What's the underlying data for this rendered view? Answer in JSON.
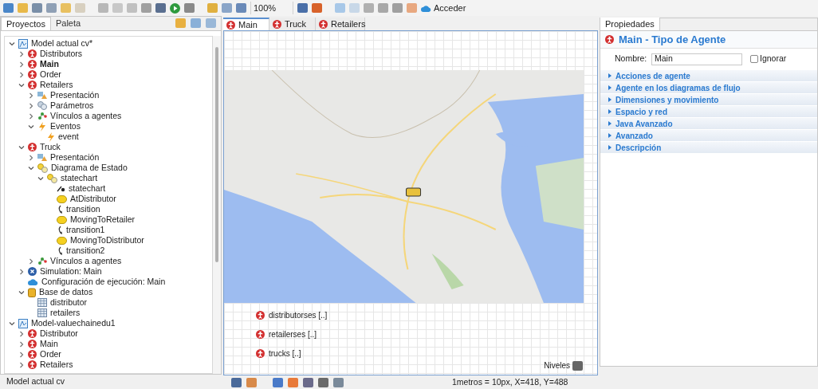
{
  "toolbar": {
    "zoom": "100%",
    "login": "Acceder"
  },
  "left_panel": {
    "tabs": [
      {
        "label": "Proyectos",
        "selected": true
      },
      {
        "label": "Paleta",
        "selected": false
      }
    ],
    "tree": [
      {
        "label": "Model actual cv*",
        "kind": "model",
        "expanded": true,
        "children": [
          {
            "label": "Distributors",
            "kind": "agent",
            "expanded": false
          },
          {
            "label": "Main",
            "kind": "agent",
            "expanded": false,
            "bold": true
          },
          {
            "label": "Order",
            "kind": "agent",
            "expanded": false
          },
          {
            "label": "Retailers",
            "kind": "agent",
            "expanded": true,
            "children": [
              {
                "label": "Presentación",
                "kind": "presentation",
                "expanded": false
              },
              {
                "label": "Parámetros",
                "kind": "parameters",
                "expanded": false
              },
              {
                "label": "Vínculos a agentes",
                "kind": "links",
                "expanded": false
              },
              {
                "label": "Eventos",
                "kind": "events",
                "expanded": true,
                "children": [
                  {
                    "label": "event",
                    "kind": "event"
                  }
                ]
              }
            ]
          },
          {
            "label": "Truck",
            "kind": "agent",
            "expanded": true,
            "children": [
              {
                "label": "Presentación",
                "kind": "presentation",
                "expanded": false
              },
              {
                "label": "Diagrama de Estado",
                "kind": "states",
                "expanded": true,
                "children": [
                  {
                    "label": "statechart",
                    "kind": "states",
                    "expanded": true,
                    "children": [
                      {
                        "label": "statechart",
                        "kind": "entry"
                      },
                      {
                        "label": "AtDistributor",
                        "kind": "state"
                      },
                      {
                        "label": "transition",
                        "kind": "transition"
                      },
                      {
                        "label": "MovingToRetailer",
                        "kind": "state"
                      },
                      {
                        "label": "transition1",
                        "kind": "transition"
                      },
                      {
                        "label": "MovingToDistributor",
                        "kind": "state"
                      },
                      {
                        "label": "transition2",
                        "kind": "transition"
                      }
                    ]
                  }
                ]
              },
              {
                "label": "Vínculos a agentes",
                "kind": "links",
                "expanded": false
              }
            ]
          },
          {
            "label": "Simulation: Main",
            "kind": "simulation",
            "expanded": false
          },
          {
            "label": "Configuración de ejecución: Main",
            "kind": "cloud"
          },
          {
            "label": "Base de datos",
            "kind": "database",
            "expanded": true,
            "children": [
              {
                "label": "distributor",
                "kind": "table"
              },
              {
                "label": "retailers",
                "kind": "table"
              }
            ]
          }
        ]
      },
      {
        "label": "Model-valuechainedu1",
        "kind": "model",
        "expanded": true,
        "children": [
          {
            "label": "Distributor",
            "kind": "agent",
            "expanded": false
          },
          {
            "label": "Main",
            "kind": "agent",
            "expanded": false
          },
          {
            "label": "Order",
            "kind": "agent",
            "expanded": false
          },
          {
            "label": "Retailers",
            "kind": "agent",
            "expanded": false
          }
        ]
      }
    ],
    "status": "Model actual cv"
  },
  "editor": {
    "tabs": [
      {
        "label": "Main",
        "selected": true
      },
      {
        "label": "Truck",
        "selected": false
      },
      {
        "label": "Retailers",
        "selected": false
      }
    ],
    "populations": [
      "distributorses [..]",
      "retailerses [..]",
      "trucks [..]"
    ],
    "levels": "Niveles",
    "scale": "1metros = 10px, X=418, Y=488"
  },
  "properties": {
    "tab": "Propiedades",
    "title": "Main - Tipo de Agente",
    "name_label": "Nombre:",
    "name_value": "Main",
    "ignore": {
      "label": "Ignorar",
      "checked": false
    },
    "sections": [
      "Acciones de agente",
      "Agente en los diagramas de flujo",
      "Dimensiones y movimiento",
      "Espacio y red",
      "Java Avanzado",
      "Avanzado",
      "Descripción"
    ]
  }
}
